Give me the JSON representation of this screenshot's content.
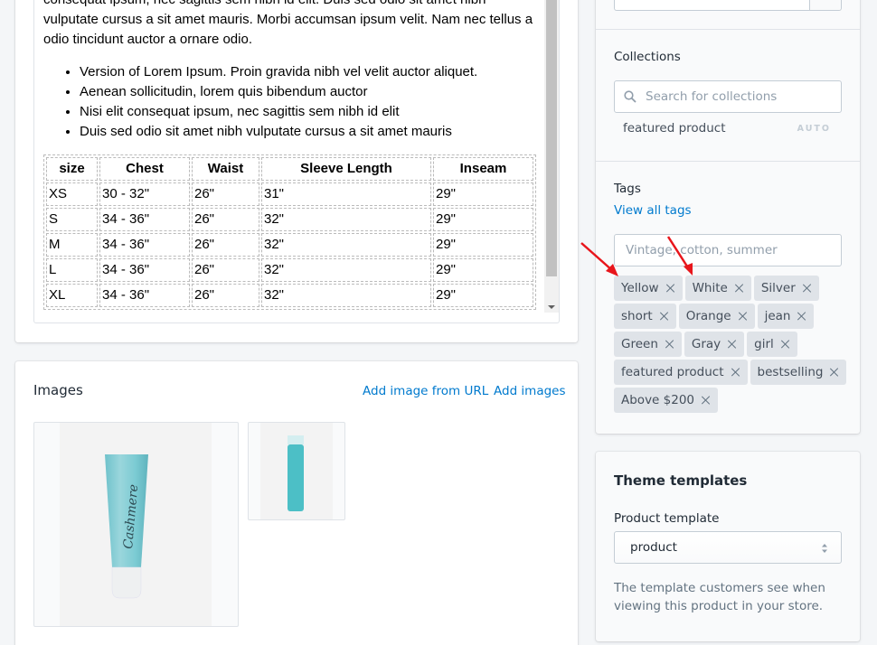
{
  "description_editor": {
    "paragraph": "consequat ipsum, nec sagittis sem nibh id elit. Duis sed odio sit amet nibh vulputate cursus a sit amet mauris. Morbi accumsan ipsum velit. Nam nec tellus a odio tincidunt auctor a ornare odio.",
    "bullets": [
      "Version of Lorem Ipsum. Proin gravida nibh vel velit auctor aliquet.",
      "Aenean sollicitudin, lorem quis bibendum auctor",
      "Nisi elit consequat ipsum, nec sagittis sem nibh id elit",
      "Duis sed odio sit amet nibh vulputate cursus a sit amet mauris"
    ],
    "size_table": {
      "headers": [
        "size",
        "Chest",
        "Waist",
        "Sleeve Length",
        "Inseam"
      ],
      "rows": [
        [
          "XS",
          "30 - 32\"",
          "26\"",
          "31\"",
          "29\""
        ],
        [
          "S",
          "34 - 36\"",
          "26\"",
          "32\"",
          "29\""
        ],
        [
          "M",
          "34 - 36\"",
          "26\"",
          "32\"",
          "29\""
        ],
        [
          "L",
          "34 - 36\"",
          "26\"",
          "32\"",
          "29\""
        ],
        [
          "XL",
          "34 - 36\"",
          "26\"",
          "32\"",
          "29\""
        ]
      ]
    }
  },
  "images": {
    "title": "Images",
    "add_from_url": "Add image from URL",
    "add_images": "Add images",
    "items": [
      {
        "alt": "Teal cosmetic tube product image"
      },
      {
        "alt": "Teal bottle product image"
      }
    ]
  },
  "collections": {
    "label": "Collections",
    "search_placeholder": "Search for collections",
    "items": [
      {
        "name": "featured product",
        "badge": "AUTO"
      }
    ]
  },
  "tags": {
    "label": "Tags",
    "view_all": "View all tags",
    "input_placeholder": "Vintage, cotton, summer",
    "items": [
      "Yellow",
      "White",
      "Silver",
      "short",
      "Orange",
      "jean",
      "Green",
      "Gray",
      "girl",
      "featured product",
      "bestselling",
      "Above $200"
    ]
  },
  "theme_templates": {
    "title": "Theme templates",
    "product_template_label": "Product template",
    "selected_template": "product",
    "help_text": "The template customers see when viewing this product in your store."
  },
  "colors": {
    "link": "#007ace",
    "tag_bg": "#dfe3e8",
    "annotation_arrow": "#e8151b"
  }
}
